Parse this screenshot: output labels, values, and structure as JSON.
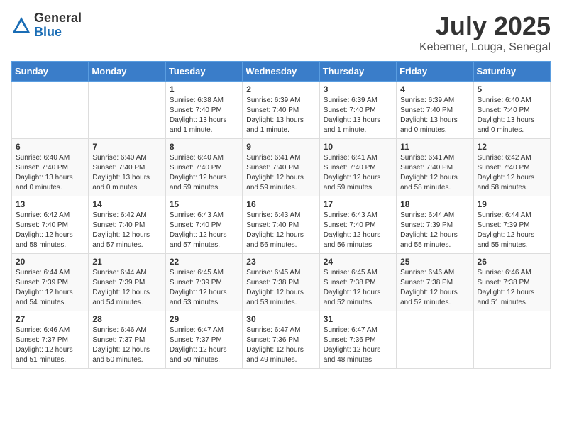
{
  "header": {
    "logo_general": "General",
    "logo_blue": "Blue",
    "month_year": "July 2025",
    "location": "Kebemer, Louga, Senegal"
  },
  "weekdays": [
    "Sunday",
    "Monday",
    "Tuesday",
    "Wednesday",
    "Thursday",
    "Friday",
    "Saturday"
  ],
  "weeks": [
    [
      {
        "day": "",
        "info": ""
      },
      {
        "day": "",
        "info": ""
      },
      {
        "day": "1",
        "info": "Sunrise: 6:38 AM\nSunset: 7:40 PM\nDaylight: 13 hours and 1 minute."
      },
      {
        "day": "2",
        "info": "Sunrise: 6:39 AM\nSunset: 7:40 PM\nDaylight: 13 hours and 1 minute."
      },
      {
        "day": "3",
        "info": "Sunrise: 6:39 AM\nSunset: 7:40 PM\nDaylight: 13 hours and 1 minute."
      },
      {
        "day": "4",
        "info": "Sunrise: 6:39 AM\nSunset: 7:40 PM\nDaylight: 13 hours and 0 minutes."
      },
      {
        "day": "5",
        "info": "Sunrise: 6:40 AM\nSunset: 7:40 PM\nDaylight: 13 hours and 0 minutes."
      }
    ],
    [
      {
        "day": "6",
        "info": "Sunrise: 6:40 AM\nSunset: 7:40 PM\nDaylight: 13 hours and 0 minutes."
      },
      {
        "day": "7",
        "info": "Sunrise: 6:40 AM\nSunset: 7:40 PM\nDaylight: 13 hours and 0 minutes."
      },
      {
        "day": "8",
        "info": "Sunrise: 6:40 AM\nSunset: 7:40 PM\nDaylight: 12 hours and 59 minutes."
      },
      {
        "day": "9",
        "info": "Sunrise: 6:41 AM\nSunset: 7:40 PM\nDaylight: 12 hours and 59 minutes."
      },
      {
        "day": "10",
        "info": "Sunrise: 6:41 AM\nSunset: 7:40 PM\nDaylight: 12 hours and 59 minutes."
      },
      {
        "day": "11",
        "info": "Sunrise: 6:41 AM\nSunset: 7:40 PM\nDaylight: 12 hours and 58 minutes."
      },
      {
        "day": "12",
        "info": "Sunrise: 6:42 AM\nSunset: 7:40 PM\nDaylight: 12 hours and 58 minutes."
      }
    ],
    [
      {
        "day": "13",
        "info": "Sunrise: 6:42 AM\nSunset: 7:40 PM\nDaylight: 12 hours and 58 minutes."
      },
      {
        "day": "14",
        "info": "Sunrise: 6:42 AM\nSunset: 7:40 PM\nDaylight: 12 hours and 57 minutes."
      },
      {
        "day": "15",
        "info": "Sunrise: 6:43 AM\nSunset: 7:40 PM\nDaylight: 12 hours and 57 minutes."
      },
      {
        "day": "16",
        "info": "Sunrise: 6:43 AM\nSunset: 7:40 PM\nDaylight: 12 hours and 56 minutes."
      },
      {
        "day": "17",
        "info": "Sunrise: 6:43 AM\nSunset: 7:40 PM\nDaylight: 12 hours and 56 minutes."
      },
      {
        "day": "18",
        "info": "Sunrise: 6:44 AM\nSunset: 7:39 PM\nDaylight: 12 hours and 55 minutes."
      },
      {
        "day": "19",
        "info": "Sunrise: 6:44 AM\nSunset: 7:39 PM\nDaylight: 12 hours and 55 minutes."
      }
    ],
    [
      {
        "day": "20",
        "info": "Sunrise: 6:44 AM\nSunset: 7:39 PM\nDaylight: 12 hours and 54 minutes."
      },
      {
        "day": "21",
        "info": "Sunrise: 6:44 AM\nSunset: 7:39 PM\nDaylight: 12 hours and 54 minutes."
      },
      {
        "day": "22",
        "info": "Sunrise: 6:45 AM\nSunset: 7:39 PM\nDaylight: 12 hours and 53 minutes."
      },
      {
        "day": "23",
        "info": "Sunrise: 6:45 AM\nSunset: 7:38 PM\nDaylight: 12 hours and 53 minutes."
      },
      {
        "day": "24",
        "info": "Sunrise: 6:45 AM\nSunset: 7:38 PM\nDaylight: 12 hours and 52 minutes."
      },
      {
        "day": "25",
        "info": "Sunrise: 6:46 AM\nSunset: 7:38 PM\nDaylight: 12 hours and 52 minutes."
      },
      {
        "day": "26",
        "info": "Sunrise: 6:46 AM\nSunset: 7:38 PM\nDaylight: 12 hours and 51 minutes."
      }
    ],
    [
      {
        "day": "27",
        "info": "Sunrise: 6:46 AM\nSunset: 7:37 PM\nDaylight: 12 hours and 51 minutes."
      },
      {
        "day": "28",
        "info": "Sunrise: 6:46 AM\nSunset: 7:37 PM\nDaylight: 12 hours and 50 minutes."
      },
      {
        "day": "29",
        "info": "Sunrise: 6:47 AM\nSunset: 7:37 PM\nDaylight: 12 hours and 50 minutes."
      },
      {
        "day": "30",
        "info": "Sunrise: 6:47 AM\nSunset: 7:36 PM\nDaylight: 12 hours and 49 minutes."
      },
      {
        "day": "31",
        "info": "Sunrise: 6:47 AM\nSunset: 7:36 PM\nDaylight: 12 hours and 48 minutes."
      },
      {
        "day": "",
        "info": ""
      },
      {
        "day": "",
        "info": ""
      }
    ]
  ]
}
